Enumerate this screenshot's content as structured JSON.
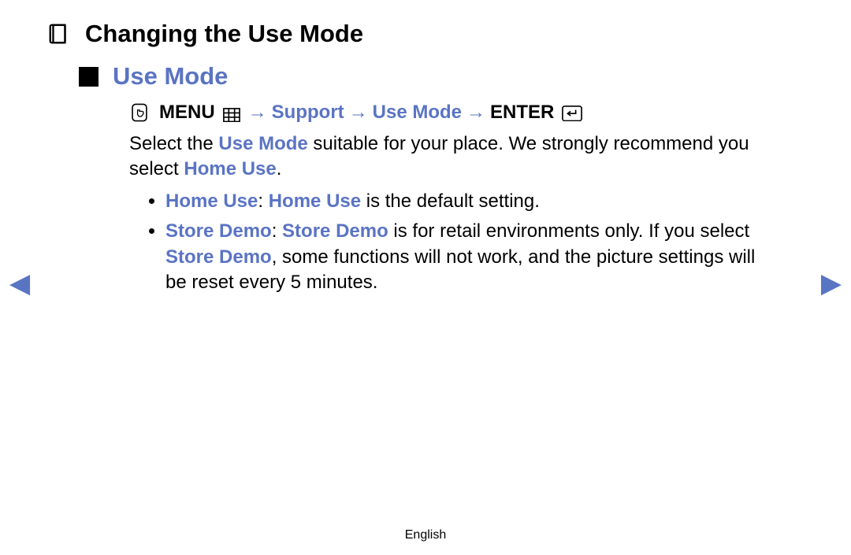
{
  "title": "Changing the Use Mode",
  "section": "Use Mode",
  "nav": {
    "menu_label": "MENU",
    "arrow": "→",
    "path1": "Support",
    "path2": "Use Mode",
    "enter_label": "ENTER"
  },
  "paragraph": {
    "t1": "Select the ",
    "h1": "Use Mode",
    "t2": " suitable for your place. We strongly recommend you select ",
    "h2": "Home Use",
    "t3": "."
  },
  "bullets": [
    {
      "h1": "Home Use",
      "t1": ": ",
      "h2": "Home Use",
      "t2": " is the default setting."
    },
    {
      "h1": "Store Demo",
      "t1": ": ",
      "h2": "Store Demo",
      "t2": " is for retail environments only. If you select ",
      "h3": "Store Demo",
      "t3": ", some functions will not work, and the picture settings will be reset every 5 minutes."
    }
  ],
  "footer": "English",
  "icons": {
    "book": "book-icon",
    "remote": "remote-hand-icon",
    "menu_glyph": "menu-grid-icon",
    "enter_glyph": "enter-return-icon",
    "left_arrow": "◀",
    "right_arrow": "▶"
  }
}
